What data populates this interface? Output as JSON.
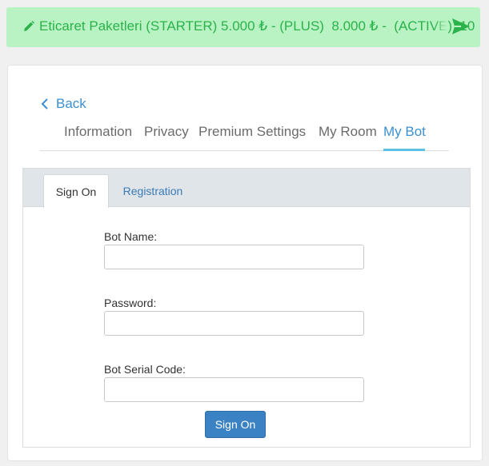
{
  "banner": {
    "promo_text": "Eticaret Paketleri (STARTER) 5.000 ₺ - (PLUS)  8.000 ₺ -  (ACTIVE)  10",
    "bg_color": "#b9f3c4",
    "text_color": "#2bb24a",
    "left_icon": "pencil-icon",
    "right_icon": "send-icon"
  },
  "nav": {
    "back_label": "Back",
    "tabs": [
      {
        "label": "Information"
      },
      {
        "label": "Privacy"
      },
      {
        "label": "Premium Settings"
      },
      {
        "label": "My Room"
      },
      {
        "label": "My Bot"
      }
    ],
    "active_tab": "My Bot",
    "accent_color": "#3c8fd0"
  },
  "form": {
    "tabs": [
      {
        "label": "Sign On"
      },
      {
        "label": "Registration"
      }
    ],
    "active_tab": "Sign On",
    "fields": [
      {
        "label": "Bot Name:",
        "value": "",
        "placeholder": ""
      },
      {
        "label": "Password:",
        "value": "",
        "placeholder": ""
      },
      {
        "label": "Bot Serial Code:",
        "value": "",
        "placeholder": ""
      }
    ],
    "submit_label": "Sign On",
    "button_color": "#3a82c4"
  }
}
